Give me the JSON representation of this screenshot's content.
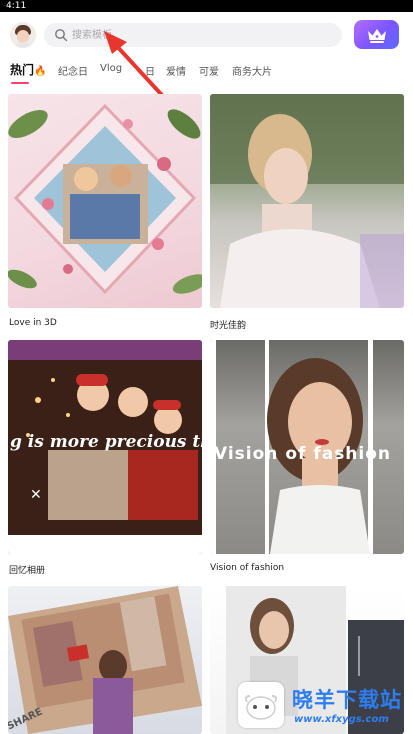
{
  "status_bar": {
    "time": "4:11"
  },
  "header": {
    "avatar_icon": "user-avatar",
    "search": {
      "placeholder": "搜索模板",
      "icon": "search-icon"
    },
    "vip_icon": "crown-icon"
  },
  "tabs": [
    {
      "label": "热门",
      "icon": "flame-icon",
      "active": true
    },
    {
      "label": "纪念日"
    },
    {
      "label": "Vlog"
    },
    {
      "label": "日"
    },
    {
      "label": "爱情"
    },
    {
      "label": "可爱"
    },
    {
      "label": "商务大片"
    }
  ],
  "templates": [
    {
      "title": "Love in 3D"
    },
    {
      "title": "时光佳韵"
    },
    {
      "title": "回忆相册",
      "overlay_text": "g is more precious than"
    },
    {
      "title": "Vision of fashion",
      "overlay_text": "Vision of fashion"
    },
    {
      "title": "",
      "overlay_text": "SHARE"
    },
    {
      "title": ""
    }
  ],
  "watermark": {
    "title": "晓羊下载站",
    "url": "www.xfxygs.com"
  },
  "colors": {
    "accent": "#ff3d6e",
    "vip_gradient_start": "#b46cff",
    "vip_gradient_end": "#5c6bff",
    "watermark": "#2d7df0"
  }
}
